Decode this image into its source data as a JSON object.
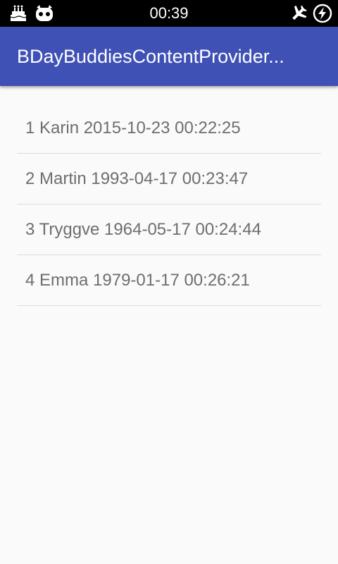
{
  "status_bar": {
    "time": "00:39",
    "left_icons": [
      "cake-icon",
      "android-icon"
    ],
    "right_icons": [
      "airplane-mode-icon",
      "battery-charging-icon"
    ]
  },
  "app_bar": {
    "title": "BDayBuddiesContentProvider...",
    "color": "#3f51b5"
  },
  "list": {
    "items": [
      {
        "text": "1 Karin 2015-10-23 00:22:25"
      },
      {
        "text": "2 Martin 1993-04-17 00:23:47"
      },
      {
        "text": "3 Tryggve 1964-05-17 00:24:44"
      },
      {
        "text": "4 Emma 1979-01-17 00:26:21"
      }
    ]
  }
}
